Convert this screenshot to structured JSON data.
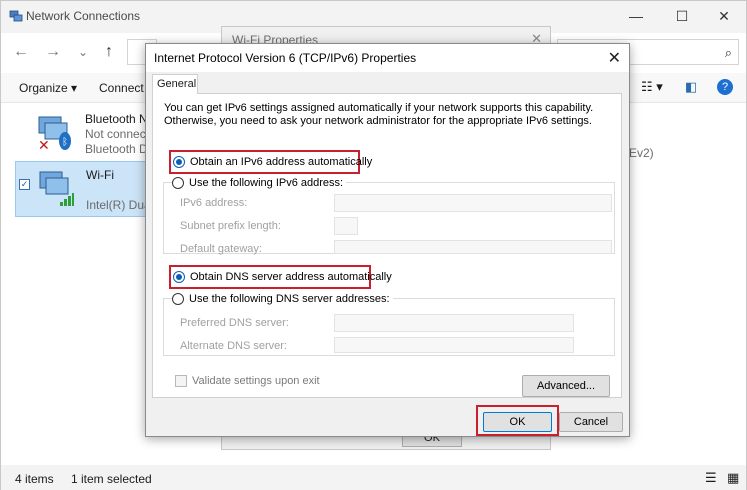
{
  "network_connections": {
    "title": "Network Connections",
    "toolbar": {
      "organize": "Organize ▾",
      "connect_to": "Connect T"
    },
    "items": [
      {
        "name": "Bluetooth Ne",
        "status": "Not connecte",
        "device": "Bluetooth De"
      },
      {
        "name": "Wi-Fi",
        "device": "Intel(R) Dual"
      }
    ],
    "side_text": "Ev2)",
    "status_bar": {
      "count": "4 items",
      "selected": "1 item selected"
    }
  },
  "wifi_properties": {
    "title": "Wi-Fi Properties",
    "ok_label": "OK"
  },
  "dialog": {
    "title": "Internet Protocol Version 6 (TCP/IPv6) Properties",
    "tab": "General",
    "description": "You can get IPv6 settings assigned automatically if your network supports this capability. Otherwise, you need to ask your network administrator for the appropriate IPv6 settings.",
    "ip_auto_label": "Obtain an IPv6 address automatically",
    "ip_manual_label": "Use the following IPv6 address:",
    "ip_fields": {
      "ipv6_address": "IPv6 address:",
      "subnet_prefix": "Subnet prefix length:",
      "default_gateway": "Default gateway:"
    },
    "dns_auto_label": "Obtain DNS server address automatically",
    "dns_manual_label": "Use the following DNS server addresses:",
    "dns_fields": {
      "preferred": "Preferred DNS server:",
      "alternate": "Alternate DNS server:"
    },
    "validate_label": "Validate settings upon exit",
    "advanced_label": "Advanced...",
    "ok_label": "OK",
    "cancel_label": "Cancel"
  },
  "colors": {
    "highlight": "#c8202f",
    "selection": "#cce4f7",
    "accent": "#0078d7"
  }
}
